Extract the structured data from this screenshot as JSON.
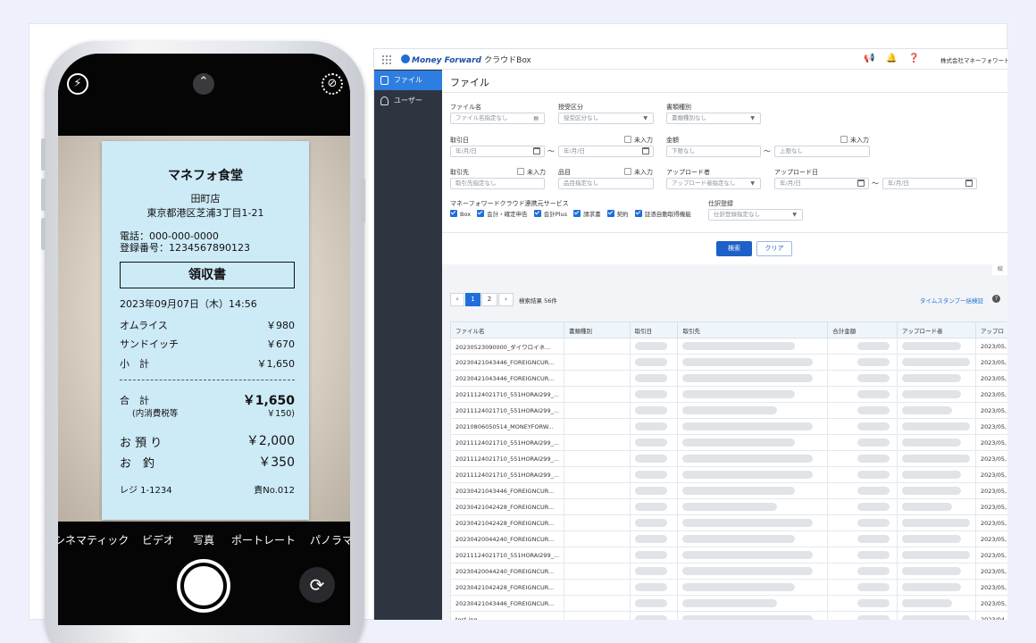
{
  "receipt": {
    "store": "マネフォ食堂",
    "branch": "田町店",
    "address": "東京都港区芝浦3丁目1-21",
    "phone": "電話：000-000-0000",
    "reg_no": "登録番号：1234567890123",
    "doc_title": "領収書",
    "datetime": "2023年09月07日（木）14:56",
    "items": [
      {
        "name": "オムライス",
        "price": "￥980"
      },
      {
        "name": "サンドイッチ",
        "price": "￥670"
      }
    ],
    "subtotal_label": "小　計",
    "subtotal": "￥1,650",
    "total_label": "合　計",
    "total": "￥1,650",
    "tax_label": "(内消費税等",
    "tax": "￥150)",
    "paid_label": "お 預 り",
    "paid": "￥2,000",
    "change_label": "お　釣",
    "change": "￥350",
    "register": "レジ 1-1234",
    "slip": "責No.012"
  },
  "camera": {
    "modes": [
      "シネマティック",
      "ビデオ",
      "写真",
      "ポートレート",
      "パノラマ"
    ],
    "active_mode": "写真",
    "icons": [
      "flash-icon",
      "chevron-up-icon",
      "live-off-icon",
      "flip-camera-icon"
    ]
  },
  "app": {
    "brand": "Money Forward",
    "brand_suffix": "クラウドBox",
    "company": "株式会社マネーフォワード",
    "sidebar": [
      {
        "label": "ファイル",
        "active": true
      },
      {
        "label": "ユーザー",
        "active": false
      }
    ],
    "page_title": "ファイル",
    "form": {
      "file_name": {
        "label": "ファイル名",
        "placeholder": "ファイル名指定なし"
      },
      "send_recv": {
        "label": "授受区分",
        "placeholder": "授受区分なし"
      },
      "doc_type": {
        "label": "書類種別",
        "placeholder": "書類種別なし"
      },
      "trade_date": {
        "label": "取引日",
        "from": "年/月/日",
        "to": "年/月/日",
        "unentered": "未入力"
      },
      "amount": {
        "label": "金額",
        "from": "下限なし",
        "to": "上限なし",
        "unentered": "未入力"
      },
      "partner": {
        "label": "取引先",
        "placeholder": "取引先指定なし",
        "unentered": "未入力"
      },
      "item": {
        "label": "品目",
        "placeholder": "品目指定なし",
        "unentered": "未入力"
      },
      "uploader": {
        "label": "アップロード者",
        "placeholder": "アップロード者指定なし"
      },
      "upload_date": {
        "label": "アップロード日",
        "from": "年/月/日",
        "to": "年/月/日"
      },
      "services_label": "マネーフォワードクラウド連携元サービス",
      "services": [
        "Box",
        "会計・確定申告",
        "会計Plus",
        "請求書",
        "契約",
        "証憑自動取得機能"
      ],
      "journal": {
        "label": "仕訳登録",
        "placeholder": "仕訳登録指定なし"
      },
      "tilde": "〜"
    },
    "buttons": {
      "search": "検索",
      "clear": "クリア"
    },
    "collapse_tab": "絞",
    "pagination": {
      "prev": "‹",
      "pages": [
        "1",
        "2"
      ],
      "next": "›",
      "result_count": "検索結果 56件"
    },
    "timestamp_link": "タイムスタンプ一括検証",
    "table": {
      "columns": [
        "ファイル名",
        "書類種別",
        "取引日",
        "取引先",
        "合計金額",
        "アップロード者",
        "アップロ"
      ],
      "rows": [
        {
          "file": "20230523090000_ダイワロイネ...",
          "date": "2023/05,"
        },
        {
          "file": "20230421043446_FOREIGNCUR...",
          "date": "2023/05,"
        },
        {
          "file": "20230421043446_FOREIGNCUR...",
          "date": "2023/05,"
        },
        {
          "file": "20211124021710_551HORAI299_...",
          "date": "2023/05,"
        },
        {
          "file": "20211124021710_551HORAI299_...",
          "date": "2023/05,"
        },
        {
          "file": "20210806050514_MONEYFORW...",
          "date": "2023/05,"
        },
        {
          "file": "20211124021710_551HORAI299_...",
          "date": "2023/05,"
        },
        {
          "file": "20211124021710_551HORAI299_...",
          "date": "2023/05,"
        },
        {
          "file": "20211124021710_551HORAI299_...",
          "date": "2023/05,"
        },
        {
          "file": "20230421043446_FOREIGNCUR...",
          "date": "2023/05,"
        },
        {
          "file": "20230421042428_FOREIGNCUR...",
          "date": "2023/05,"
        },
        {
          "file": "20230421042428_FOREIGNCUR...",
          "date": "2023/05,"
        },
        {
          "file": "20230420044240_FOREIGNCUR...",
          "date": "2023/05,"
        },
        {
          "file": "20211124021710_551HORAI299_...",
          "date": "2023/05,"
        },
        {
          "file": "20230420044240_FOREIGNCUR...",
          "date": "2023/05,"
        },
        {
          "file": "20230421042428_FOREIGNCUR...",
          "date": "2023/05,"
        },
        {
          "file": "20230421043446_FOREIGNCUR...",
          "date": "2023/05,"
        },
        {
          "file": "test.jpg",
          "date": "2023/04,"
        }
      ]
    }
  }
}
